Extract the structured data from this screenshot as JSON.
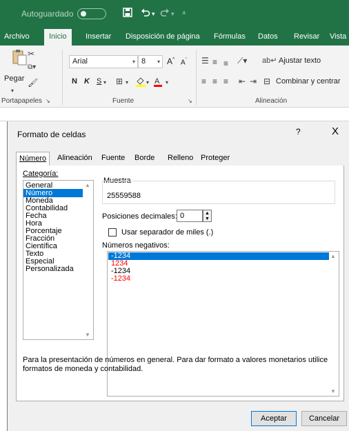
{
  "titlebar": {
    "autosave_label": "Autoguardado",
    "autosave_state": "off",
    "icons": [
      "save-icon",
      "undo-icon",
      "redo-icon",
      "customize-qat-icon"
    ]
  },
  "ribbon_tabs": [
    "Archivo",
    "Inicio",
    "Insertar",
    "Disposición de página",
    "Fórmulas",
    "Datos",
    "Revisar",
    "Vista"
  ],
  "active_ribbon_tab": "Inicio",
  "ribbon": {
    "paste_label": "Pegar",
    "font_name": "Arial",
    "font_size": "8",
    "bold": "N",
    "italic": "K",
    "underline": "S",
    "wrap_text": "Ajustar texto",
    "merge_center": "Combinar y centrar",
    "groups": {
      "clipboard": "Portapapeles",
      "font": "Fuente",
      "alignment": "Alineación"
    }
  },
  "dialog": {
    "title": "Formato de celdas",
    "help": "?",
    "close": "X",
    "tabs": [
      "Número",
      "Alineación",
      "Fuente",
      "Borde",
      "Relleno",
      "Proteger"
    ],
    "active_tab": "Número",
    "category_label": "Categoría:",
    "categories": [
      "General",
      "Número",
      "Moneda",
      "Contabilidad",
      "Fecha",
      "Hora",
      "Porcentaje",
      "Fracción",
      "Científica",
      "Texto",
      "Especial",
      "Personalizada"
    ],
    "selected_category": "Número",
    "sample_label": "Muestra",
    "sample_value": "25559588",
    "decimals_label": "Posiciones decimales:",
    "decimals_value": "0",
    "separator_label": "Usar separador de miles (.)",
    "separator_checked": false,
    "negatives_label": "Números negativos:",
    "negatives": [
      {
        "text": "-1234",
        "color": "#000000"
      },
      {
        "text": "1234",
        "color": "#ff0000"
      },
      {
        "text": "-1234",
        "color": "#000000"
      },
      {
        "text": "-1234",
        "color": "#ff0000"
      }
    ],
    "selected_negative_index": 0,
    "description": "Para la presentación de números en general. Para dar formato a valores monetarios utilice formatos de moneda y contabilidad.",
    "ok_label": "Aceptar",
    "cancel_label": "Cancelar"
  },
  "colors": {
    "excel_green": "#217346",
    "selection_blue": "#0078d7",
    "negative_red": "#ff0000"
  }
}
